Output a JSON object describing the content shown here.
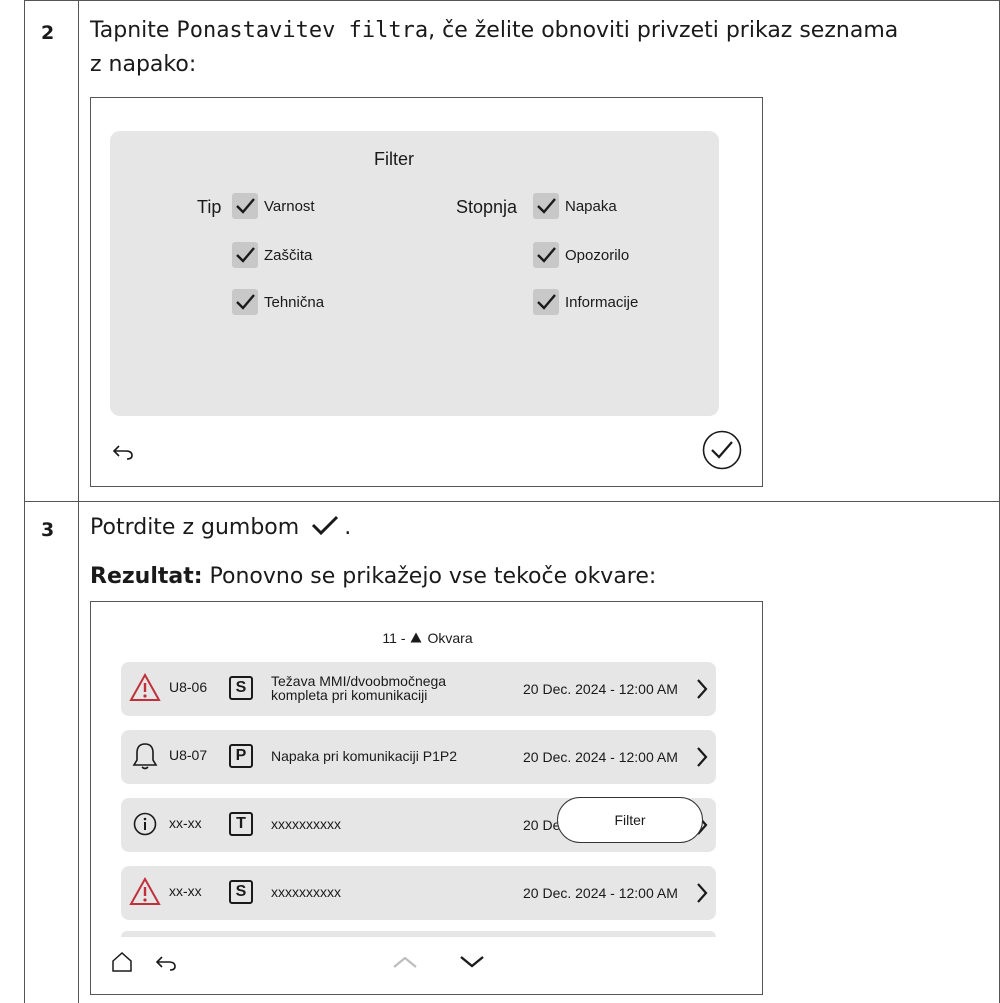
{
  "step2": {
    "number": "2",
    "text_before": "Tapnite ",
    "code": "Ponastavitev filtra",
    "text_after": ", če želite obnoviti privzeti prikaz seznama",
    "line2": "z napako:"
  },
  "filter_screen": {
    "title": "Filter",
    "tip_label": "Tip",
    "stopnja_label": "Stopnja",
    "tip_options": [
      {
        "label": "Varnost",
        "checked": true
      },
      {
        "label": "Zaščita",
        "checked": true
      },
      {
        "label": "Tehnična",
        "checked": true
      }
    ],
    "stopnja_options": [
      {
        "label": "Napaka",
        "checked": true
      },
      {
        "label": "Opozorilo",
        "checked": true
      },
      {
        "label": "Informacije",
        "checked": true
      }
    ],
    "icons": {
      "back": "back-arrow-icon",
      "confirm": "confirm-check-circle-icon"
    },
    "panel_color": "#e6e6e6"
  },
  "step3": {
    "number": "3",
    "text": "Potrdite z gumbom",
    "text_end": ".",
    "result_label": "Rezultat:",
    "result_text": " Ponovno se prikažejo vse tekoče okvare:"
  },
  "error_list": {
    "header_count": "11 -",
    "header_title": "Okvara",
    "rows": [
      {
        "icon": "warning-triangle-icon",
        "code": "U8-06",
        "category": "S",
        "desc1": "Težava MMI/dvoobmočnega",
        "desc2": "kompleta pri komunikaciji",
        "date": "20 Dec. 2024 - 12:00 AM"
      },
      {
        "icon": "bell-icon",
        "code": "U8-07",
        "category": "P",
        "desc1": "Napaka pri komunikaciji P1P2",
        "desc2": "",
        "date": "20 Dec. 2024 - 12:00 AM"
      },
      {
        "icon": "info-circle-icon",
        "code": "xx-xx",
        "category": "T",
        "desc1": "xxxxxxxxxx",
        "desc2": "",
        "date": "20 Dec. 2024 - 12:00 AM"
      },
      {
        "icon": "warning-triangle-icon",
        "code": "xx-xx",
        "category": "S",
        "desc1": "xxxxxxxxxx",
        "desc2": "",
        "date": "20 Dec. 2024 - 12:00 AM"
      }
    ],
    "filter_button": "Filter",
    "warning_color": "#c0303a"
  }
}
